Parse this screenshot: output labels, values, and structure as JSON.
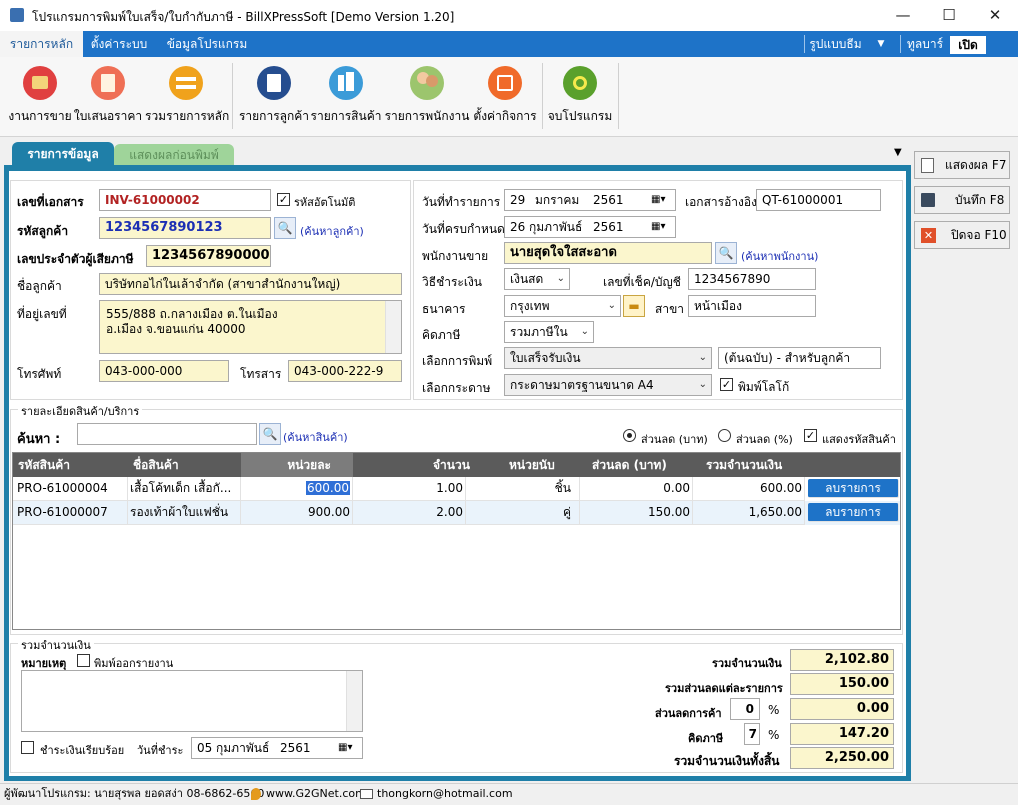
{
  "window": {
    "title": "โปรแกรมการพิมพ์ใบเสร็จ/ใบกำกับภาษี - BillXPressSoft [Demo Version 1.20]",
    "minimize": "—",
    "maximize": "☐",
    "close": "✕"
  },
  "menubar": {
    "tabs": [
      "รายการหลัก",
      "ตั้งค่าระบบ",
      "ข้อมูลโปรแกรม"
    ],
    "right": {
      "theme": "รูปแบบธีม",
      "toolbar": "ทูลบาร์",
      "toggle": "เปิด"
    }
  },
  "ribbon": {
    "buttons": [
      {
        "label": "งานการขาย",
        "icon": "cash-register-icon",
        "color": "#e04040"
      },
      {
        "label": "ใบเสนอราคา",
        "icon": "quotation-icon",
        "color": "#ef6f55"
      },
      {
        "label": "รวมรายการหลัก",
        "icon": "exchange-icon",
        "color": "#f0a21c"
      },
      {
        "label": "รายการลูกค้า",
        "icon": "customer-card-icon",
        "color": "#254d8f"
      },
      {
        "label": "รายการสินค้า",
        "icon": "buildings-icon",
        "color": "#3b9bd8"
      },
      {
        "label": "รายการพนักงาน",
        "icon": "employees-icon",
        "color": "#9cc56d"
      },
      {
        "label": "ตั้งค่ากิจการ",
        "icon": "business-settings-icon",
        "color": "#f06a2a"
      },
      {
        "label": "จบโปรแกรม",
        "icon": "power-icon",
        "color": "#5aa02c"
      }
    ]
  },
  "tabs": {
    "active": "รายการข้อมูล",
    "inactive": "แสดงผลก่อนพิมพ์"
  },
  "side_buttons": [
    {
      "label": "แสดงผล F7",
      "icon": "document-icon"
    },
    {
      "label": "บันทึก F8",
      "icon": "save-icon"
    },
    {
      "label": "ปิดจอ F10",
      "icon": "close-box-icon"
    }
  ],
  "doc": {
    "doc_no_label": "เลขที่เอกสาร",
    "doc_no": "INV-61000002",
    "auto_code_label": "รหัสอัตโนมัติ",
    "auto_code_checked": "✓",
    "cust_code_label": "รหัสลูกค้า",
    "cust_code": "1234567890123",
    "find_customer": "(ค้นหาลูกค้า)",
    "tax_id_label": "เลขประจำตัวผู้เสียภาษี",
    "tax_id": "1234567890000",
    "cust_name_label": "ชื่อลูกค้า",
    "cust_name": "บริษัทกอไก่ในเล้าจำกัด (สาขาสำนักงานใหญ่)",
    "address_label": "ที่อยู่เลขที่",
    "address_line1": "555/888 ถ.กลางเมือง ต.ในเมือง",
    "address_line2": "อ.เมือง จ.ขอนแก่น 40000",
    "phone_label": "โทรศัพท์",
    "phone": "043-000-000",
    "fax_label": "โทรสาร",
    "fax": "043-000-222-9"
  },
  "txn": {
    "date_label": "วันที่ทำรายการ",
    "date_day": "29",
    "date_month": "มกราคม",
    "date_year": "2561",
    "ref_label": "เอกสารอ้างอิง",
    "ref": "QT-61000001",
    "due_label": "วันที่ครบกำหนด",
    "due_day": "26",
    "due_month": "กุมภาพันธ์",
    "due_year": "2561",
    "salesman_label": "พนักงานขาย",
    "salesman": "นายสุดใจใสสะอาด",
    "find_salesman": "(ค้นหาพนักงาน)",
    "payment_label": "วิธีชำระเงิน",
    "payment": "เงินสด",
    "cheque_label": "เลขที่เช็ค/บัญชี",
    "cheque": "1234567890",
    "bank_label": "ธนาคาร",
    "bank": "กรุงเทพ",
    "branch_label": "สาขา",
    "branch": "หน้าเมือง",
    "tax_label": "คิดภาษี",
    "tax": "รวมภาษีใน",
    "print_label": "เลือกการพิมพ์",
    "print_type": "ใบเสร็จรับเงิน",
    "print_copy": "(ต้นฉบับ) - สำหรับลูกค้า",
    "paper_label": "เลือกกระดาษ",
    "paper": "กระดาษมาตรฐานขนาด A4",
    "logo_label": "พิมพ์โลโก้",
    "logo_checked": "✓"
  },
  "items_section": {
    "title": "รายละเอียดสินค้า/บริการ",
    "search_label": "ค้นหา :",
    "search_value": "",
    "find_product": "(ค้นหาสินค้า)",
    "discount_baht": "ส่วนลด (บาท)",
    "discount_pct": "ส่วนลด (%)",
    "show_code": "แสดงรหัสสินค้า",
    "show_code_checked": "✓"
  },
  "grid": {
    "columns": [
      "รหัสสินค้า",
      "ชื่อสินค้า",
      "หน่วยละ",
      "จำนวน",
      "หน่วยนับ",
      "ส่วนลด (บาท)",
      "รวมจำนวนเงิน"
    ],
    "rows": [
      {
        "code": "PRO-61000004",
        "name": "เสื้อโค้ทเด็ก เสื้อกั...",
        "price": "600.00",
        "qty": "1.00",
        "unit": "ชิ้น",
        "discount": "0.00",
        "total": "600.00",
        "action": "ลบรายการ"
      },
      {
        "code": "PRO-61000007",
        "name": "รองเท้าผ้าใบแฟชั่น",
        "price": "900.00",
        "qty": "2.00",
        "unit": "คู่",
        "discount": "150.00",
        "total": "1,650.00",
        "action": "ลบรายการ"
      }
    ]
  },
  "totals_section": {
    "title": "รวมจำนวนเงิน",
    "note_label": "หมายเหตุ",
    "print_note_label": "พิมพ์ออกรายงาน",
    "paid_label": "ชำระเงินเรียบร้อย",
    "pay_date_label": "วันที่ชำระ",
    "pay_day": "05",
    "pay_month": "กุมภาพันธ์",
    "pay_year": "2561",
    "sum_label": "รวมจำนวนเงิน",
    "sum": "2,102.80",
    "item_discount_label": "รวมส่วนลดแต่ละรายการ",
    "item_discount": "150.00",
    "cust_discount_label": "ส่วนลดการค้า",
    "cust_discount_pct": "0",
    "cust_discount": "0.00",
    "vat_label": "คิดภาษี",
    "vat_pct": "7",
    "vat": "147.20",
    "grand_label": "รวมจำนวนเงินทั้งสิ้น",
    "grand": "2,250.00",
    "pct_sign": "%"
  },
  "status": {
    "developer": "ผู้พัฒนาโปรแกรม: นายสุรพล ยอดสง่า 08-6862-6560",
    "website": "www.G2GNet.com",
    "email": "thongkorn@hotmail.com"
  }
}
